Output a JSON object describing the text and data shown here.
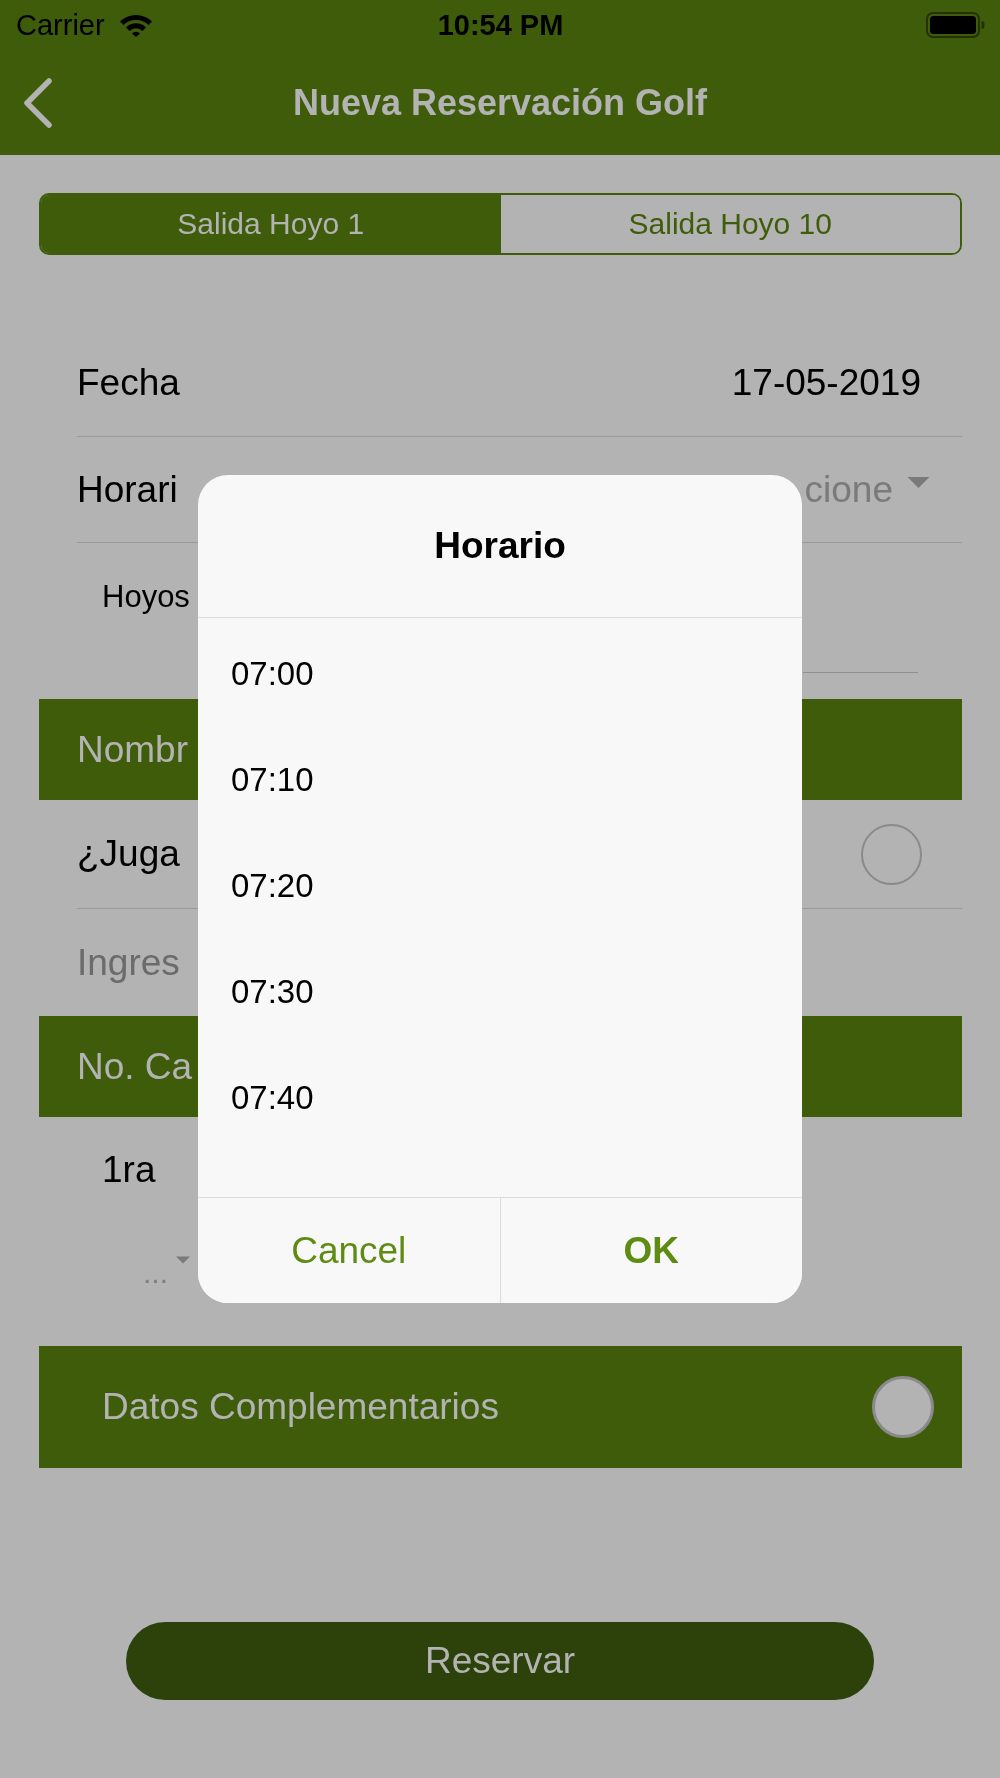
{
  "status_bar": {
    "carrier": "Carrier",
    "time": "10:54 PM"
  },
  "nav": {
    "title": "Nueva Reservación Golf"
  },
  "tabs": [
    {
      "label": "Salida Hoyo 1",
      "selected": true
    },
    {
      "label": "Salida Hoyo 10",
      "selected": false
    }
  ],
  "date_row": {
    "label": "Fecha",
    "value": "17-05-2019"
  },
  "schedule_row": {
    "label": "Horari",
    "placeholder": "cione"
  },
  "holes_row": {
    "label": "Hoyos"
  },
  "player_section": {
    "title": "Nombr",
    "guest_toggle": {
      "label": "¿Juga",
      "checked": false
    },
    "name_field": {
      "placeholder": "Ingres"
    }
  },
  "cart_section": {
    "title": "No. Ca",
    "cart": "1ra",
    "cart_picker": {
      "value": "..."
    }
  },
  "extra_section": {
    "title": "Datos Complementarios",
    "checked": false
  },
  "submit_button": {
    "label": "Reservar"
  },
  "dialog": {
    "title": "Horario",
    "options": [
      "07:00",
      "07:10",
      "07:20",
      "07:30",
      "07:40"
    ],
    "buttons": [
      {
        "label": "Cancel",
        "kind": "cancel"
      },
      {
        "label": "OK",
        "kind": "confirm"
      }
    ]
  }
}
